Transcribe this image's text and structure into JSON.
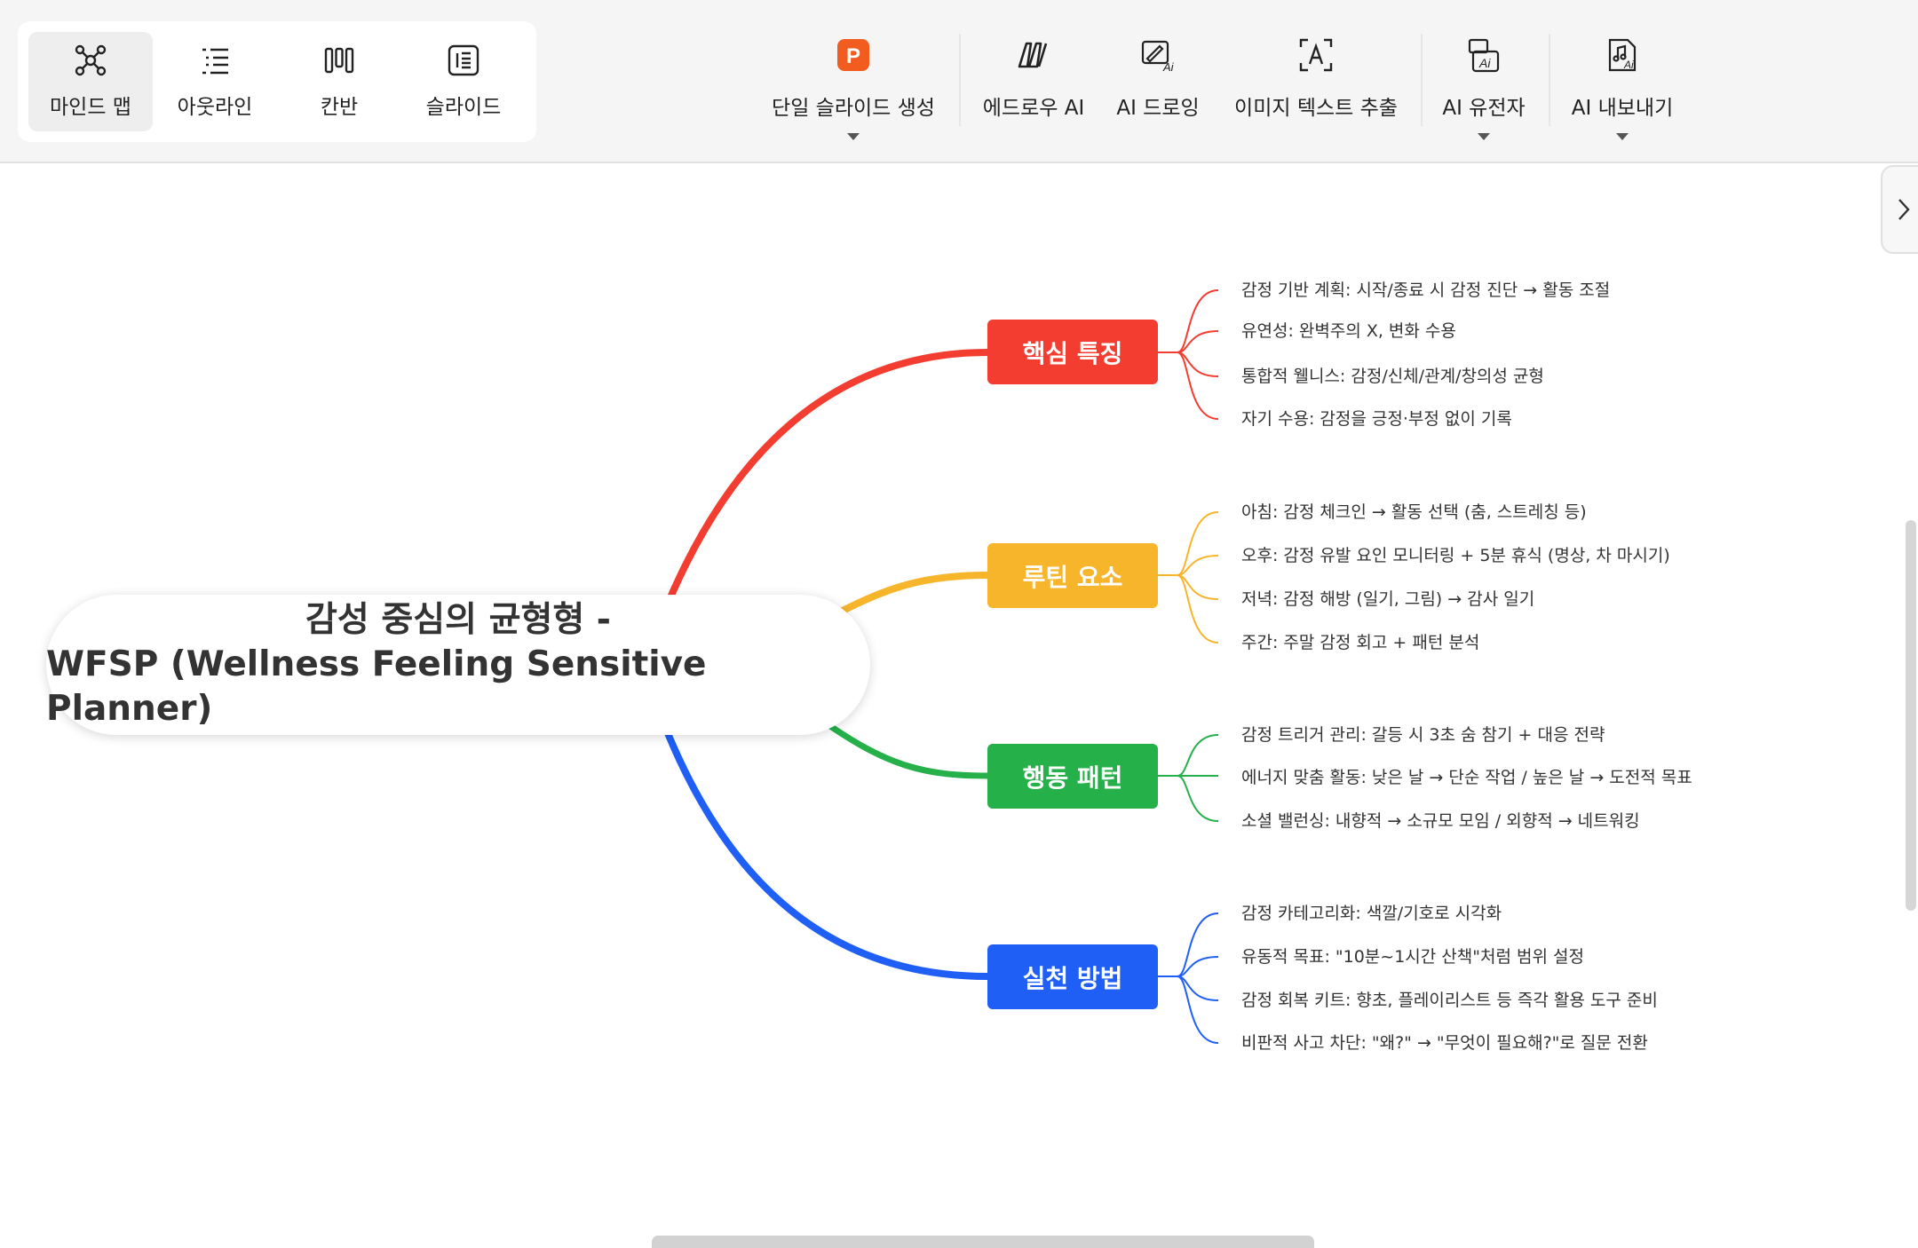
{
  "views": [
    {
      "label": "마인드 맵",
      "icon": "mindmap-icon",
      "active": true
    },
    {
      "label": "아웃라인",
      "icon": "outline-icon",
      "active": false
    },
    {
      "label": "칸반",
      "icon": "kanban-icon",
      "active": false
    },
    {
      "label": "슬라이드",
      "icon": "slide-icon",
      "active": false
    }
  ],
  "tools": [
    {
      "label": "단일 슬라이드 생성",
      "icon": "powerpoint-icon",
      "dropdown": true,
      "icon_color": "#f25c1f"
    },
    {
      "label": "에드로우 AI",
      "icon": "edraw-ai-icon",
      "dropdown": false
    },
    {
      "label": "AI 드로잉",
      "icon": "ai-drawing-icon",
      "dropdown": false
    },
    {
      "label": "이미지 텍스트 추출",
      "icon": "ocr-icon",
      "dropdown": false
    },
    {
      "label": "AI 유전자",
      "icon": "ai-gene-icon",
      "dropdown": true
    },
    {
      "label": "AI 내보내기",
      "icon": "ai-export-icon",
      "dropdown": true
    }
  ],
  "mindmap": {
    "root": {
      "line1": "감성 중심의 균형형 -",
      "line2": "WFSP (Wellness Feeling Sensitive Planner)"
    },
    "branches": [
      {
        "label": "핵심 특징",
        "color": "#f23d30",
        "children": [
          "감정 기반 계획: 시작/종료 시 감정 진단 → 활동 조절",
          "유연성: 완벽주의 X, 변화 수용",
          "통합적 웰니스: 감정/신체/관계/창의성 균형",
          "자기 수용: 감정을 긍정·부정 없이 기록"
        ]
      },
      {
        "label": "루틴 요소",
        "color": "#f7b52b",
        "children": [
          "아침: 감정 체크인 → 활동 선택 (춤, 스트레칭 등)",
          "오후: 감정 유발 요인 모니터링 + 5분 휴식 (명상, 차 마시기)",
          "저녁: 감정 해방 (일기, 그림) → 감사 일기",
          "주간: 주말 감정 회고 + 패턴 분석"
        ]
      },
      {
        "label": "행동 패턴",
        "color": "#25b04a",
        "children": [
          "감정 트리거 관리: 갈등 시 3초 숨 참기 + 대응 전략",
          "에너지 맞춤 활동: 낮은 날 → 단순 작업 / 높은 날 → 도전적 목표",
          "소셜 밸런싱: 내향적 → 소규모 모임 / 외향적 → 네트워킹"
        ]
      },
      {
        "label": "실천 방법",
        "color": "#1f5ff5",
        "children": [
          "감정 카테고리화: 색깔/기호로 시각화",
          "유동적 목표: \"10분~1시간 산책\"처럼 범위 설정",
          "감정 회복 키트: 향초, 플레이리스트 등 즉각 활용 도구 준비",
          "비판적 사고 차단: \"왜?\" → \"무엇이 필요해?\"로 질문 전환"
        ]
      }
    ]
  }
}
